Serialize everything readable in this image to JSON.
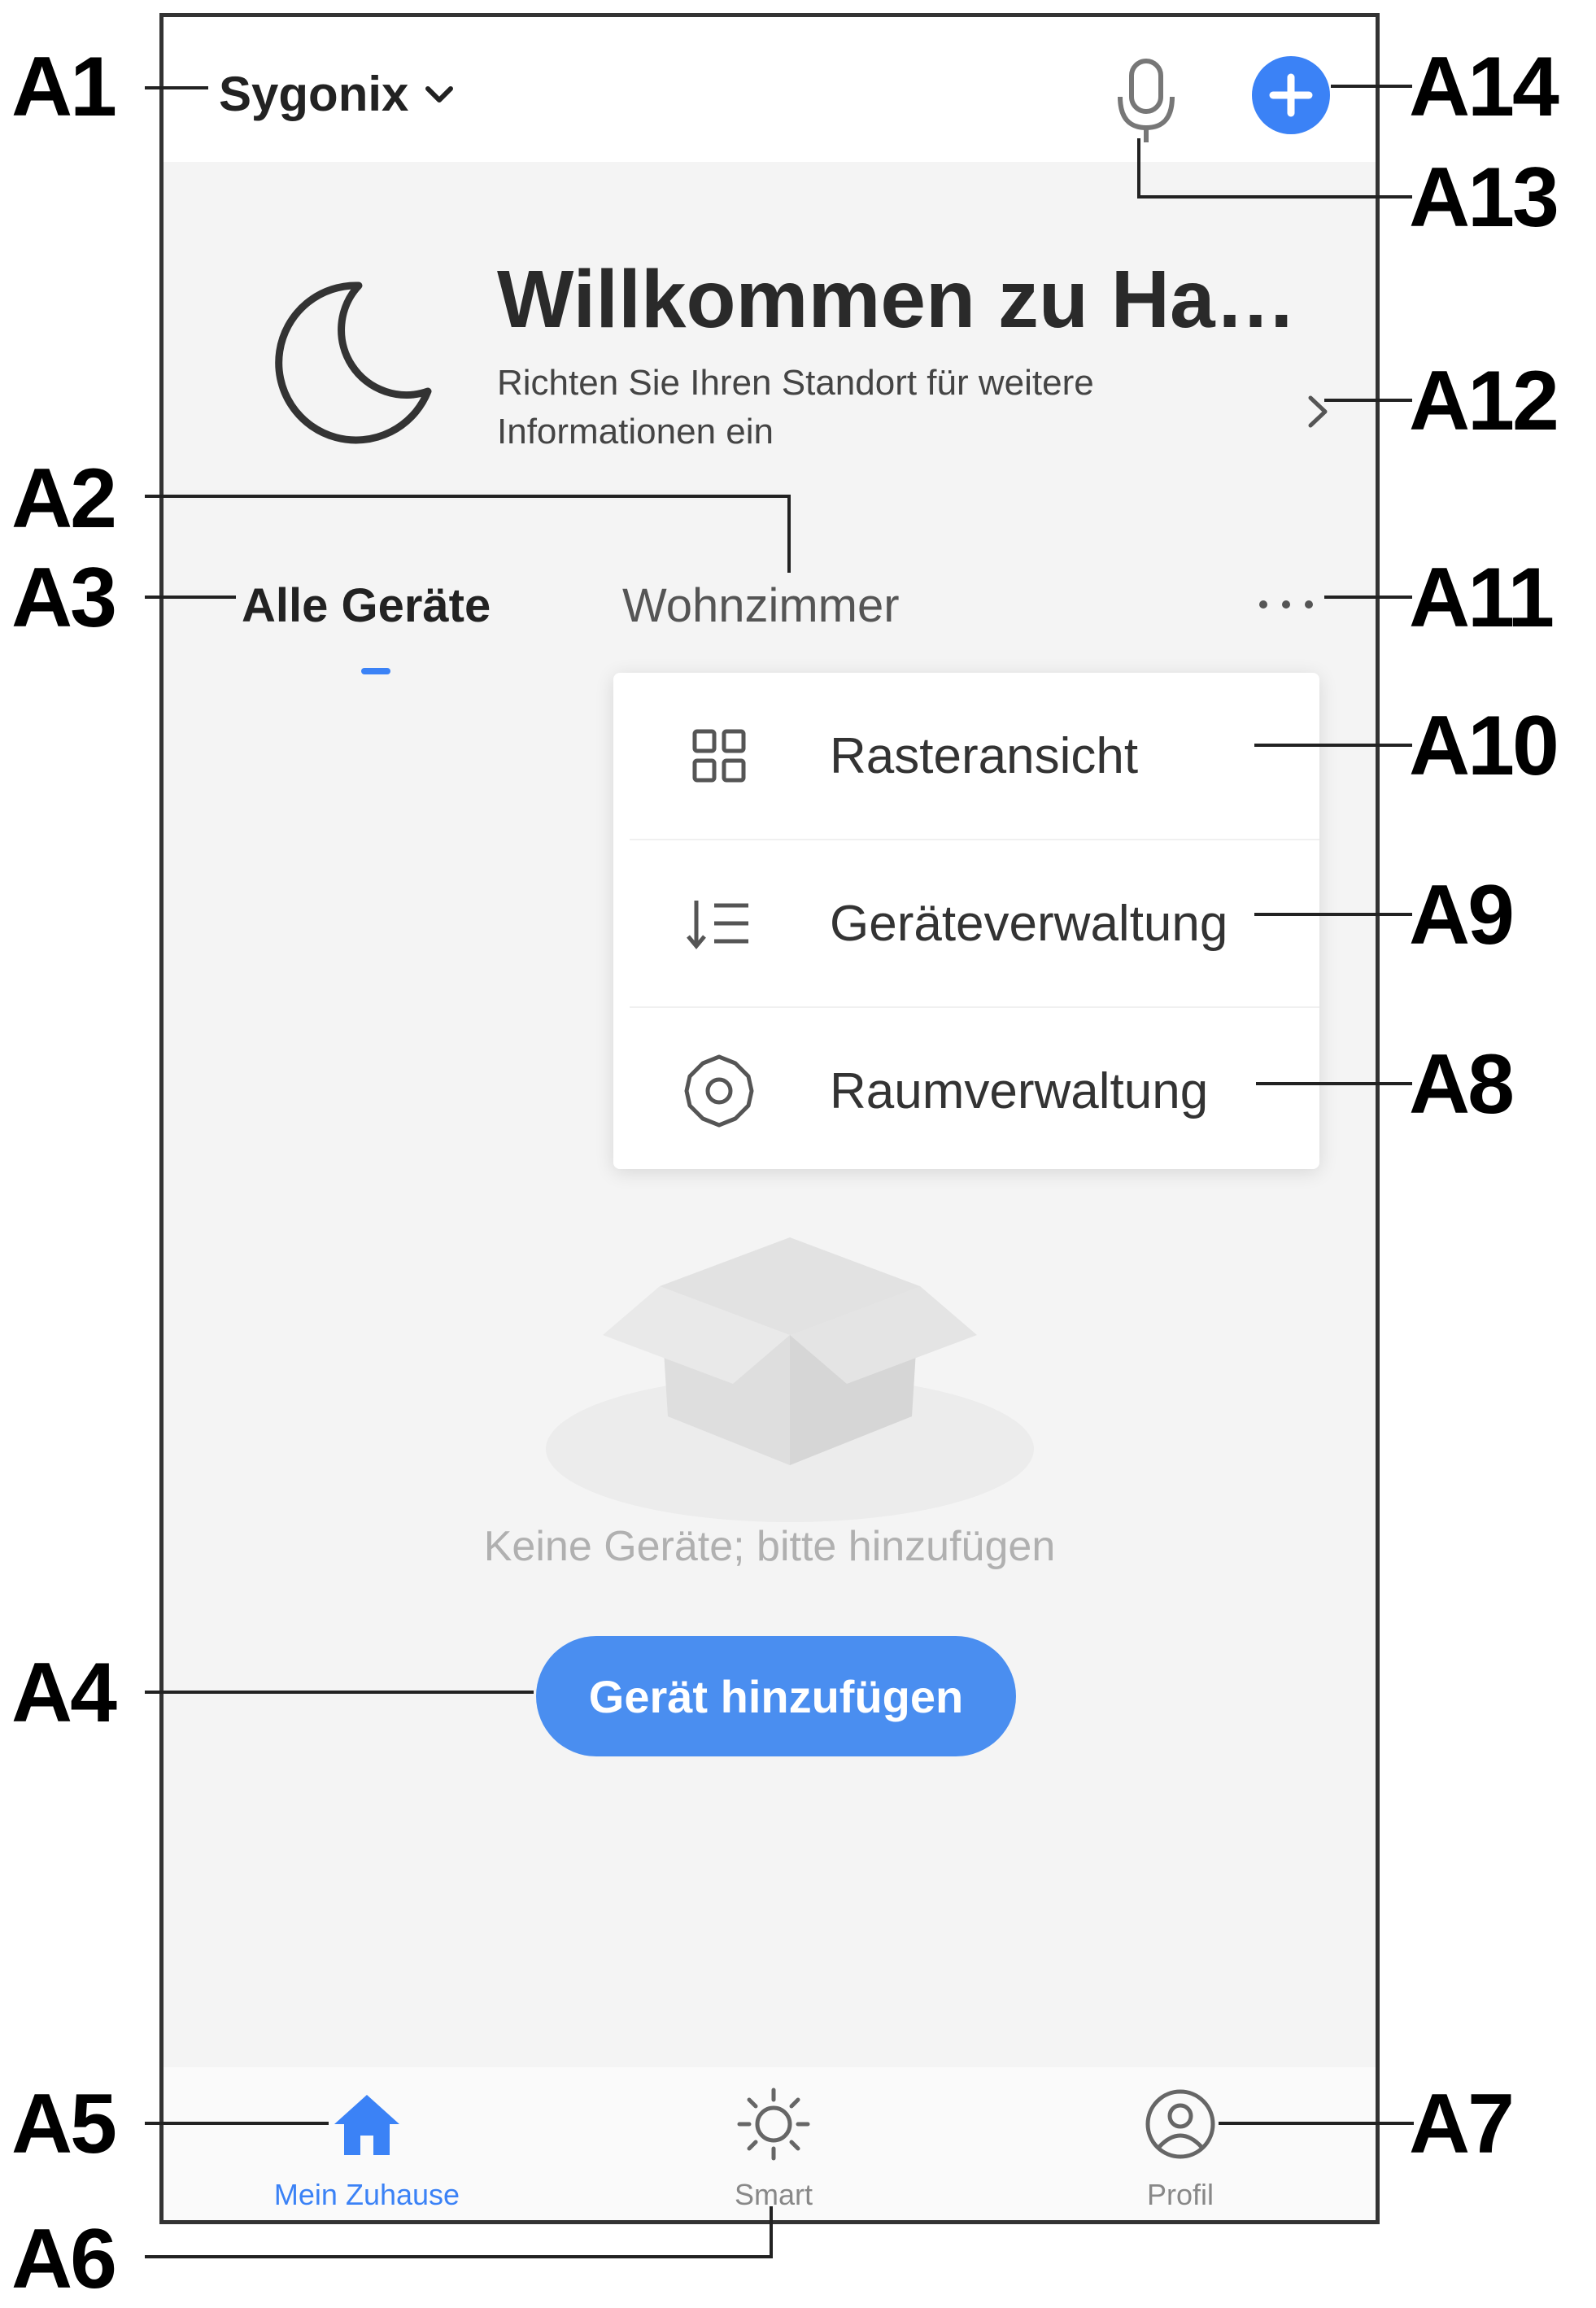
{
  "header": {
    "home_name": "Sygonix"
  },
  "welcome": {
    "title": "Willkommen zu Ha…",
    "subtitle": "Richten Sie Ihren Standort für weitere Informationen ein"
  },
  "tabs": [
    {
      "label": "Alle Geräte",
      "active": true
    },
    {
      "label": "Wohnzimmer",
      "active": false
    }
  ],
  "menu": {
    "items": [
      {
        "label": "Rasteransicht",
        "icon": "grid-icon"
      },
      {
        "label": "Geräteverwaltung",
        "icon": "sort-list-icon"
      },
      {
        "label": "Raumverwaltung",
        "icon": "gear-icon"
      }
    ]
  },
  "empty_state": {
    "message": "Keine Geräte; bitte hinzufügen",
    "button_label": "Gerät hinzufügen"
  },
  "bottom_nav": {
    "items": [
      {
        "label": "Mein Zuhause",
        "icon": "home-icon",
        "active": true
      },
      {
        "label": "Smart",
        "icon": "sun-icon",
        "active": false
      },
      {
        "label": "Profil",
        "icon": "profile-icon",
        "active": false
      }
    ]
  },
  "annotations": [
    "A1",
    "A2",
    "A3",
    "A4",
    "A5",
    "A6",
    "A7",
    "A8",
    "A9",
    "A10",
    "A11",
    "A12",
    "A13",
    "A14"
  ],
  "colors": {
    "accent": "#3b82f6",
    "button": "#4a8ef0",
    "background": "#f4f4f4"
  }
}
